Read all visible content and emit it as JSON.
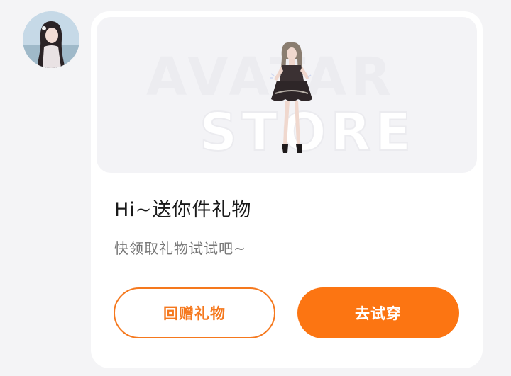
{
  "sender": {
    "avatar_icon": "user-avatar"
  },
  "gift_card": {
    "banner": {
      "watermark_line1": "AVATAR",
      "watermark_line2": "STORE",
      "character_icon": "avatar-outfit-figure"
    },
    "title": "Hi~送你件礼物",
    "subtitle": "快领取礼物试试吧~",
    "buttons": {
      "return_gift": "回赠礼物",
      "try_on": "去试穿"
    },
    "colors": {
      "accent": "#fc7512",
      "outline": "#f5781d",
      "card_bg": "#ffffff",
      "page_bg": "#f4f4f6"
    }
  }
}
